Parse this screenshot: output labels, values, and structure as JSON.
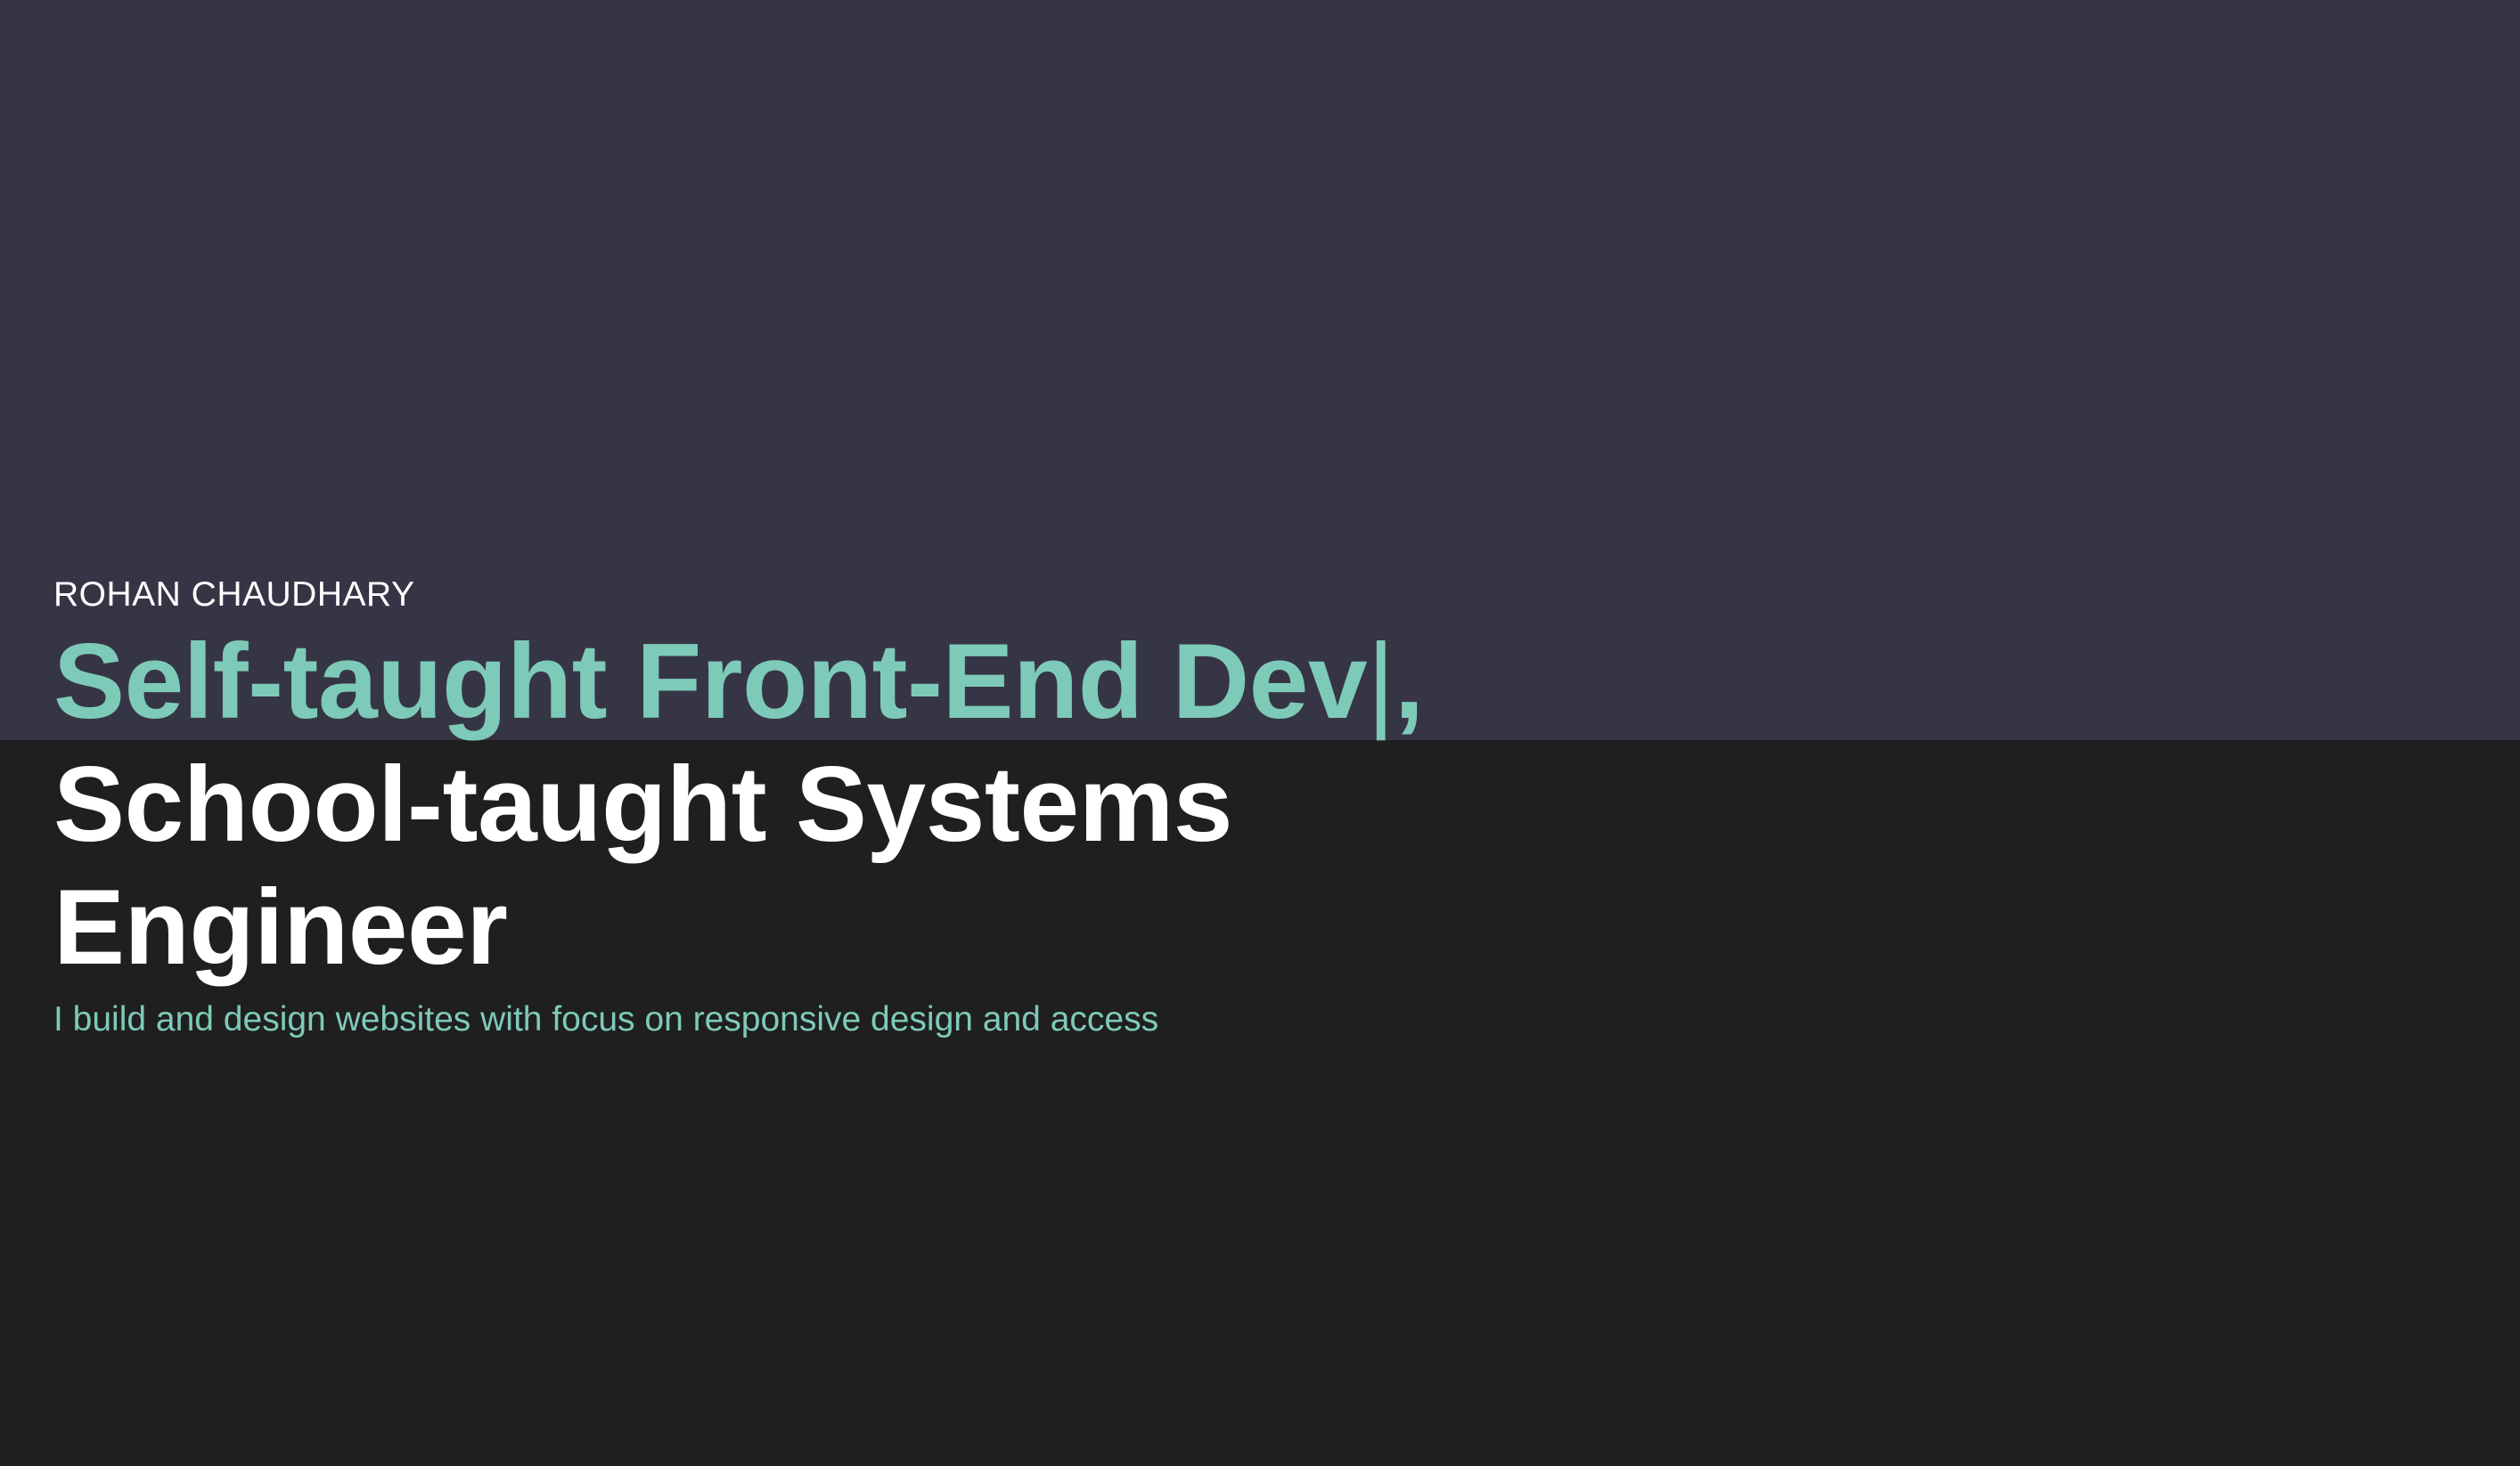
{
  "hero": {
    "name": "ROHAN CHAUDHARY",
    "headline_typed": "Self-taught Front-End Dev",
    "cursor": "|",
    "headline_comma": ",",
    "headline_rest": "School-taught Systems Engineer",
    "tagline": "I build and design websites with focus on responsive design and access"
  },
  "colors": {
    "top_background": "#363546",
    "bottom_background": "#1f1f1f",
    "accent": "#7ecab8",
    "text": "#ffffff"
  }
}
